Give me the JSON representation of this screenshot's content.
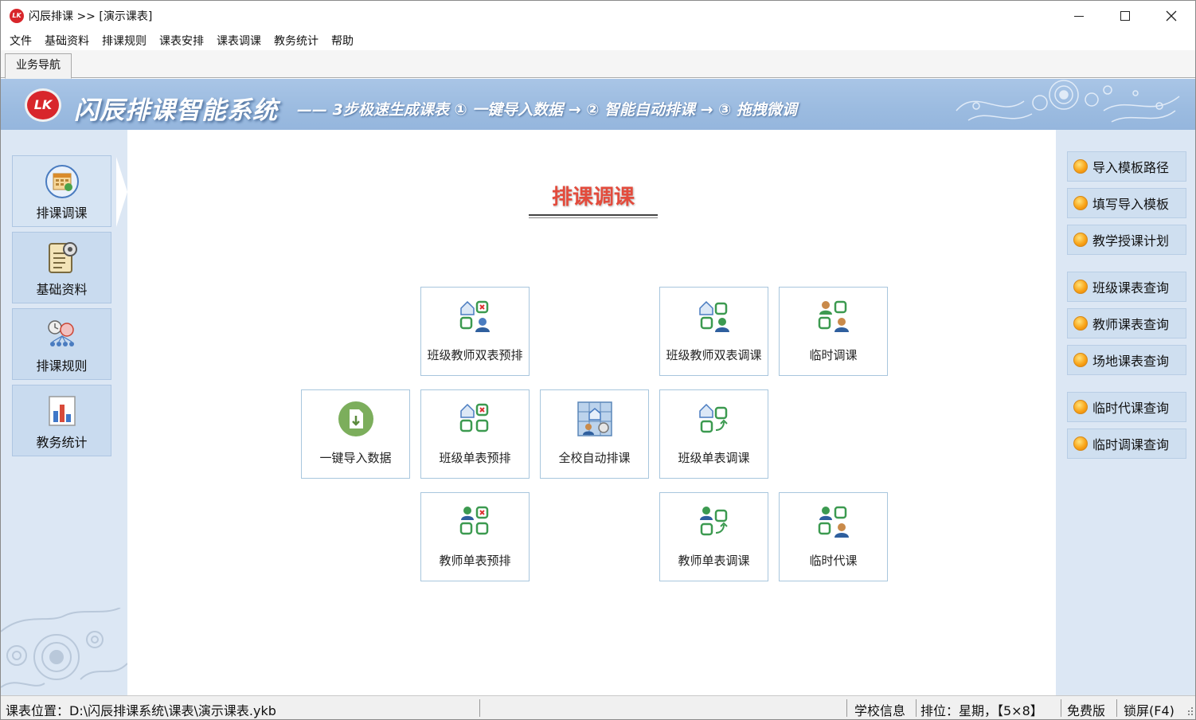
{
  "titlebar": {
    "title": "闪辰排课 >> [演示课表]",
    "logo_text": "LK",
    "minimize_icon": "minimize-icon",
    "maximize_icon": "maximize-icon",
    "close_icon": "close-icon"
  },
  "menu": {
    "items": [
      "文件",
      "基础资料",
      "排课规则",
      "课表安排",
      "课表调课",
      "教务统计",
      "帮助"
    ]
  },
  "tabs": {
    "active": "业务导航"
  },
  "banner": {
    "logo_text": "LK",
    "title": "闪辰排课智能系统",
    "slogan": "—— 3步极速生成课表   ① 一键导入数据 → ② 智能自动排课 → ③ 拖拽微调"
  },
  "left_nav": {
    "items": [
      {
        "label": "排课调课",
        "icon": "schedule-calendar-icon",
        "active": true
      },
      {
        "label": "基础资料",
        "icon": "document-gear-icon",
        "active": false
      },
      {
        "label": "排课规则",
        "icon": "rules-network-icon",
        "active": false
      },
      {
        "label": "教务统计",
        "icon": "bar-chart-icon",
        "active": false
      }
    ]
  },
  "main": {
    "title": "排课调课",
    "tiles": {
      "class_teacher_dual_prearrange": "班级教师双表预排",
      "class_teacher_dual_adjust": "班级教师双表调课",
      "temporary_adjust": "临时调课",
      "one_click_import": "一键导入数据",
      "class_single_prearrange": "班级单表预排",
      "school_auto_arrange": "全校自动排课",
      "class_single_adjust": "班级单表调课",
      "teacher_single_prearrange": "教师单表预排",
      "teacher_single_adjust": "教师单表调课",
      "temporary_substitute": "临时代课"
    }
  },
  "right_nav": {
    "items": [
      "导入模板路径",
      "填写导入模板",
      "教学授课计划",
      "班级课表查询",
      "教师课表查询",
      "场地课表查询",
      "临时代课查询",
      "临时调课查询"
    ]
  },
  "status": {
    "path": "课表位置：D:\\闪辰排课系统\\课表\\演示课表.ykb",
    "school_info": "学校信息",
    "arrangement": "排位：星期，【5×8】",
    "edition": "免费版",
    "lock": "锁屏(F4)"
  },
  "colors": {
    "banner_bg": "#9bbbe0",
    "sidebar_bg": "#dce7f4",
    "title_red": "#e34b3c",
    "tile_border": "#a8c6dd"
  }
}
